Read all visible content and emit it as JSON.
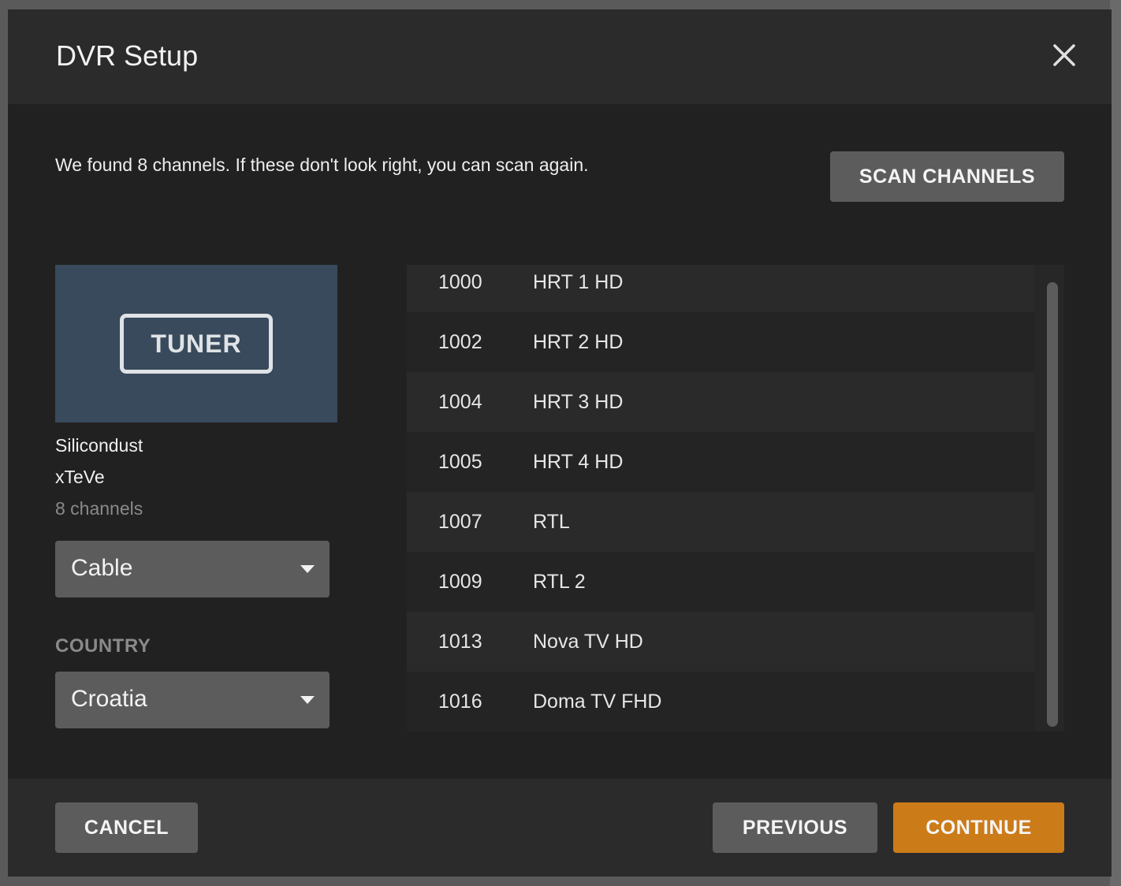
{
  "dialog": {
    "title": "DVR Setup",
    "close_icon": "close-icon"
  },
  "intro_text": "We found 8 channels. If these don't look right, you can scan again.",
  "scan_button": "SCAN CHANNELS",
  "device": {
    "tuner_badge": "TUNER",
    "brand": "Silicondust",
    "model": "xTeVe",
    "channel_count": "8 channels"
  },
  "signal_select": {
    "value": "Cable"
  },
  "country": {
    "label": "COUNTRY",
    "value": "Croatia"
  },
  "channels": [
    {
      "number": "1000",
      "name": "HRT 1 HD"
    },
    {
      "number": "1002",
      "name": "HRT 2 HD"
    },
    {
      "number": "1004",
      "name": "HRT 3 HD"
    },
    {
      "number": "1005",
      "name": "HRT 4 HD"
    },
    {
      "number": "1007",
      "name": "RTL"
    },
    {
      "number": "1009",
      "name": "RTL 2"
    },
    {
      "number": "1013",
      "name": "Nova TV HD"
    },
    {
      "number": "1016",
      "name": "Doma TV FHD"
    }
  ],
  "footer": {
    "cancel": "CANCEL",
    "previous": "PREVIOUS",
    "continue": "CONTINUE"
  },
  "colors": {
    "accent": "#cc7b19",
    "modal_bg": "#212121",
    "button_grey": "#5c5c5c",
    "tuner_card_bg": "#384a5b"
  }
}
